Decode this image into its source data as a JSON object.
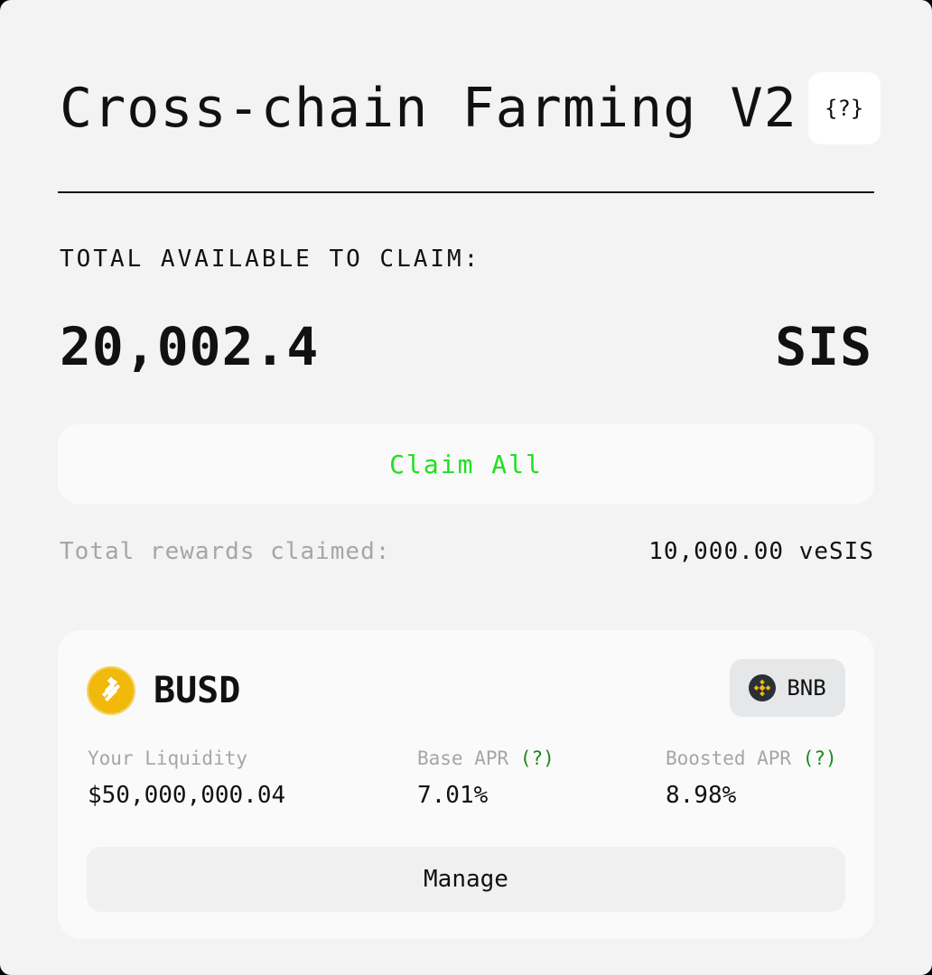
{
  "header": {
    "title": "Cross-chain Farming V2",
    "help_label": "{?}"
  },
  "claim": {
    "label": "TOTAL AVAILABLE TO CLAIM:",
    "amount": "20,002.4",
    "token": "SIS",
    "button_label": "Claim All",
    "button_color": "#1fe01f"
  },
  "rewards": {
    "label": "Total rewards claimed:",
    "value": "10,000.00 veSIS"
  },
  "pool": {
    "token_icon": "busd-icon",
    "token_name": "BUSD",
    "chain_icon": "bnb-icon",
    "chain_name": "BNB",
    "liquidity_label": "Your Liquidity",
    "liquidity_value": "$50,000,000.04",
    "base_apr_label": "Base APR",
    "base_apr_help": "(?)",
    "base_apr_value": "7.01%",
    "boosted_apr_label": "Boosted APR",
    "boosted_apr_help": "(?)",
    "boosted_apr_value": "8.98%",
    "manage_label": "Manage"
  }
}
